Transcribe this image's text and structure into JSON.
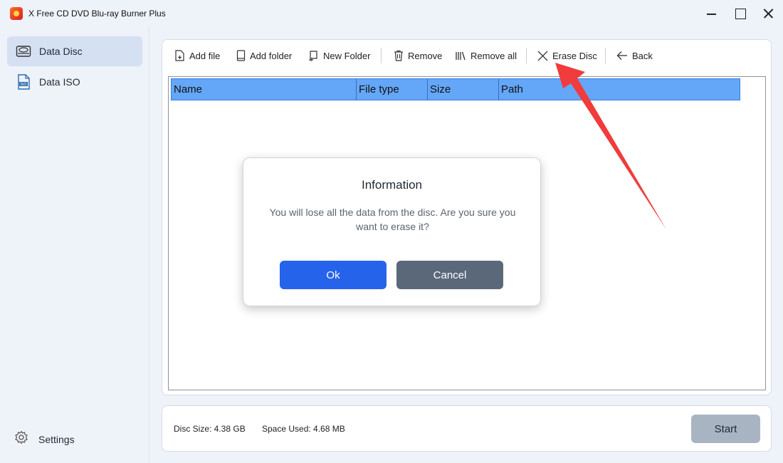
{
  "window": {
    "title": "X Free CD DVD Blu-ray Burner Plus"
  },
  "sidebar": {
    "items": [
      {
        "label": "Data Disc",
        "icon": "disc-drive-icon",
        "active": true
      },
      {
        "label": "Data ISO",
        "icon": "iso-file-icon",
        "active": false
      }
    ],
    "settings_label": "Settings"
  },
  "toolbar": {
    "add_file": "Add file",
    "add_folder": "Add folder",
    "new_folder": "New Folder",
    "remove": "Remove",
    "remove_all": "Remove all",
    "erase_disc": "Erase Disc",
    "back": "Back"
  },
  "table": {
    "columns": [
      "Name",
      "File type",
      "Size",
      "Path"
    ]
  },
  "dialog": {
    "title": "Information",
    "message": "You will lose all the data from the disc. Are you sure you want to erase it?",
    "ok_label": "Ok",
    "cancel_label": "Cancel"
  },
  "status": {
    "disc_size": "Disc Size: 4.38 GB",
    "space_used": "Space Used: 4.68 MB",
    "start_label": "Start"
  },
  "colors": {
    "accent": "#2563eb",
    "header": "#64a6f8",
    "annotation": "#f03c3c"
  }
}
